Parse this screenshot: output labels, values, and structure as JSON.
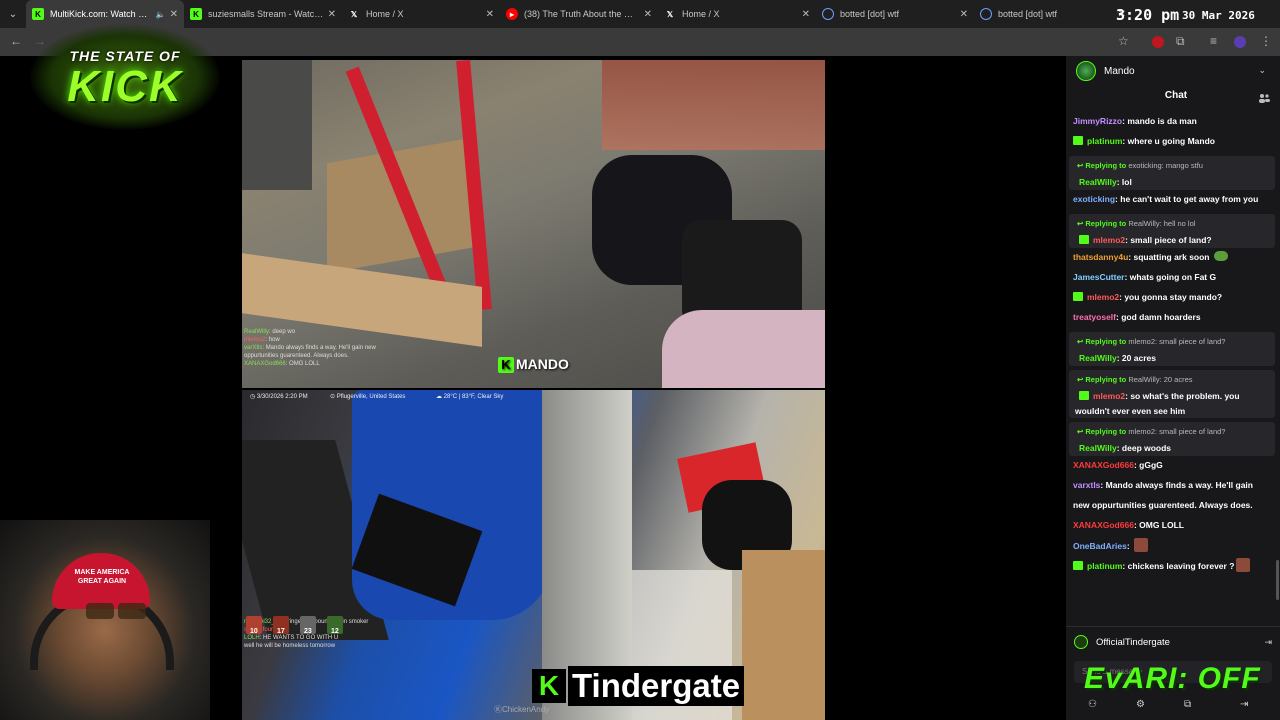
{
  "browser": {
    "tabs": [
      {
        "title": "MultiKick.com: Watch Multi",
        "icon": "kick-icon",
        "color": "#53fc18",
        "active": true,
        "muted_speaker": true
      },
      {
        "title": "suziesmalls Stream - Watch Live",
        "icon": "kick-icon",
        "color": "#53fc18",
        "active": false
      },
      {
        "title": "Home / X",
        "icon": "x-icon",
        "color": "#ffffff",
        "active": false
      },
      {
        "title": "(38) The Truth About the Girl B",
        "icon": "youtube-icon",
        "color": "#ff0000",
        "active": false
      },
      {
        "title": "Home / X",
        "icon": "x-icon",
        "color": "#ffffff",
        "active": false
      },
      {
        "title": "botted [dot] wtf",
        "icon": "globe-icon",
        "color": "#6aa0ff",
        "active": false
      },
      {
        "title": "botted [dot] wtf",
        "icon": "globe-icon",
        "color": "#6aa0ff",
        "active": false
      }
    ],
    "clock": "3:20 pm",
    "date": "30 Mar 2026"
  },
  "logo": {
    "line1": "THE STATE OF",
    "line2": "KICK"
  },
  "top_stream": {
    "streamer": "MANDO",
    "mini_chat": [
      {
        "user": "RealWilly",
        "text": "deep wo"
      },
      {
        "user": "mlemo2",
        "text": "how"
      },
      {
        "user": "varXtls",
        "text": "Mando always finds a way. He'll gain new"
      },
      {
        "user": "",
        "text": "oppurtunities guarenteed. Always does."
      },
      {
        "user": "XANAXGod666",
        "text": "OMG LOLL"
      }
    ]
  },
  "bottom_stream": {
    "datetime": "3/30/2026 2:20 PM",
    "location": "Pflugerville, United States",
    "weather": "28°C | 83°F, Clear Sky",
    "counts": [
      "10",
      "17",
      "23",
      "12"
    ],
    "mini_chat": [
      {
        "user": "michael32_32",
        "text": "cringe 500 pound chain smoker"
      },
      {
        "user": "spasticfours",
        "text": ""
      },
      {
        "user": "LOLH",
        "text": "HE WANTS TO GO WITH U"
      },
      {
        "user": "",
        "text": "well he will be homeless tomorrow"
      }
    ],
    "caption": "Tindergate",
    "watermark": "ChickenAndy"
  },
  "webcam": {
    "cap_text": "MAKE AMERICA GREAT AGAIN"
  },
  "chat": {
    "channel": "Mando",
    "title": "Chat",
    "messages": [
      {
        "kind": "msg",
        "user": "JimmyRizzo",
        "color": "#c58fff",
        "text": "mando is da man",
        "badge": false
      },
      {
        "kind": "msg",
        "user": "platinum",
        "color": "#53fc18",
        "text": "where u going Mando",
        "badge": true
      },
      {
        "kind": "reply",
        "reply_to": "exoticking",
        "reply_text": "mango stfu",
        "user": "RealWilly",
        "color": "#53fc18",
        "text": "lol",
        "badge": false
      },
      {
        "kind": "msg",
        "user": "exoticking",
        "color": "#7fb0ff",
        "text": "he can't wait to get away from you",
        "badge": false
      },
      {
        "kind": "reply",
        "reply_to": "RealWilly",
        "reply_text": "hell no lol",
        "user": "mlemo2",
        "color": "#ff5a5a",
        "text": "small piece of land?",
        "badge": true
      },
      {
        "kind": "msg",
        "user": "thatsdanny4u",
        "color": "#f0a030",
        "text": "squatting ark soon",
        "badge": false,
        "emote": "frog"
      },
      {
        "kind": "msg",
        "user": "JamesCutter",
        "color": "#7fd0ff",
        "text": "whats going on Fat G",
        "badge": false
      },
      {
        "kind": "msg",
        "user": "mlemo2",
        "color": "#ff5a5a",
        "text": "you gonna stay mando?",
        "badge": true
      },
      {
        "kind": "msg",
        "user": "treatyoself",
        "color": "#ff6fb0",
        "text": "god damn hoarders",
        "badge": false
      },
      {
        "kind": "reply",
        "reply_to": "mlemo2",
        "reply_text": "small piece of land?",
        "user": "RealWilly",
        "color": "#53fc18",
        "text": "20 acres",
        "badge": false
      },
      {
        "kind": "reply2",
        "reply_to": "RealWilly",
        "reply_text": "20 acres",
        "user": "mlemo2",
        "color": "#ff5a5a",
        "text": "so what's the problem. you",
        "text2": "wouldn't ever even see him",
        "badge": true
      },
      {
        "kind": "reply",
        "reply_to": "mlemo2",
        "reply_text": "small piece of land?",
        "user": "RealWilly",
        "color": "#53fc18",
        "text": "deep woods",
        "badge": false
      },
      {
        "kind": "msg",
        "user": "XANAXGod666",
        "color": "#ff3b3b",
        "text": "gGgG",
        "badge": false
      },
      {
        "kind": "msg",
        "user": "varxtls",
        "color": "#c58fff",
        "text": "Mando always finds a way. He'll gain",
        "badge": false
      },
      {
        "kind": "cont",
        "text": "new oppurtunities guarenteed. Always does."
      },
      {
        "kind": "msg",
        "user": "XANAXGod666",
        "color": "#ff3b3b",
        "text": "OMG LOLL",
        "badge": false
      },
      {
        "kind": "msg",
        "user": "OneBadAries",
        "color": "#7fb0ff",
        "text": "",
        "badge": false,
        "emote": "img"
      },
      {
        "kind": "msg",
        "user": "platinum",
        "color": "#53fc18",
        "text": "chickens leaving forever ?",
        "badge": true,
        "emote": "img"
      }
    ],
    "reply_prefix": "Replying to",
    "sender_name": "OfficialTindergate",
    "input_placeholder": "Send a message",
    "evari_banner": "EvARI: OFF"
  }
}
